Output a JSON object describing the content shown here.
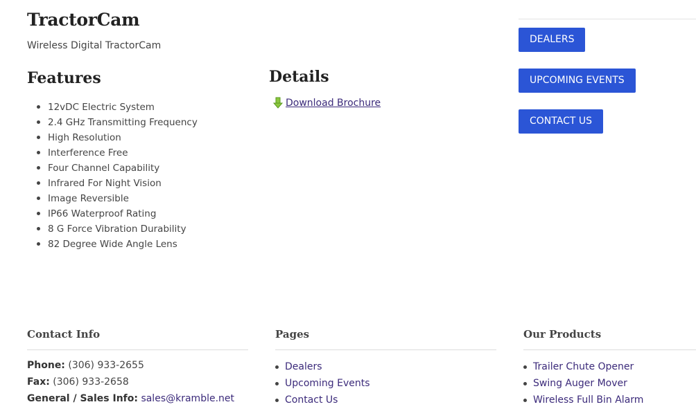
{
  "product": {
    "title": "TractorCam",
    "subtitle": "Wireless Digital TractorCam"
  },
  "features": {
    "heading": "Features",
    "items": [
      "12vDC Electric System",
      "2.4 GHz Transmitting Frequency",
      "High Resolution",
      "Interference Free",
      "Four Channel Capability",
      "Infrared For Night Vision",
      "Image Reversible",
      "IP66 Waterproof Rating",
      "8 G Force Vibration Durability",
      "82 Degree Wide Angle Lens"
    ]
  },
  "details": {
    "heading": "Details",
    "download_label": "Download Brochure",
    "download_icon": "download-arrow-icon"
  },
  "sidebar": {
    "buttons": [
      "DEALERS",
      "UPCOMING EVENTS",
      "CONTACT US"
    ],
    "button_color": "#2b55d6"
  },
  "footer": {
    "contact": {
      "heading": "Contact Info",
      "phone_label": "Phone:",
      "phone": "(306) 933-2655",
      "fax_label": "Fax:",
      "fax": "(306) 933-2658",
      "sales_label": "General / Sales Info:",
      "email": "sales@kramble.net"
    },
    "pages": {
      "heading": "Pages",
      "items": [
        "Dealers",
        "Upcoming Events",
        "Contact Us"
      ]
    },
    "products": {
      "heading": "Our Products",
      "items": [
        "Trailer Chute Opener",
        "Swing Auger Mover",
        "Wireless Full Bin Alarm"
      ]
    }
  }
}
